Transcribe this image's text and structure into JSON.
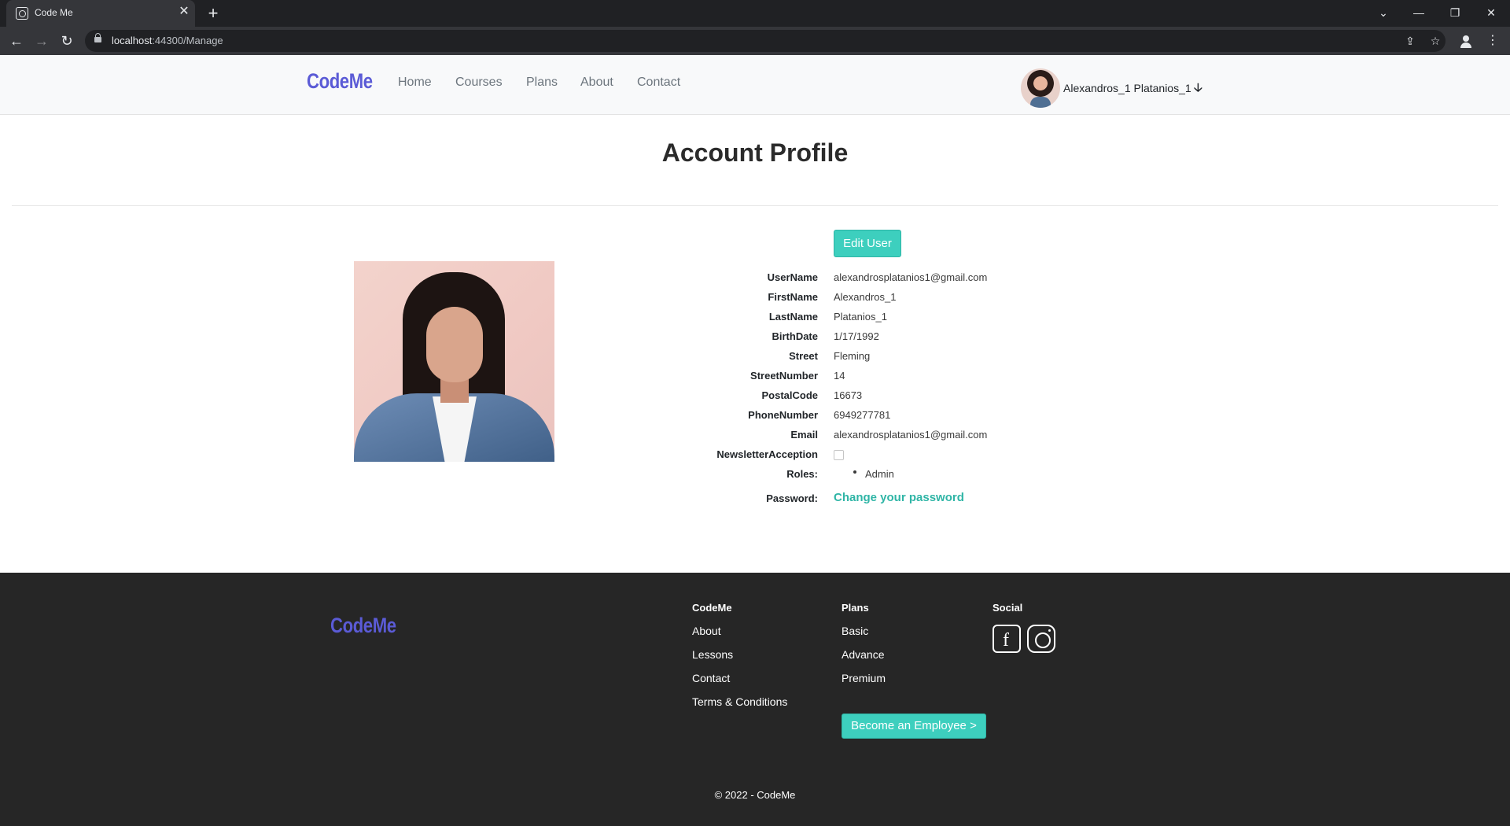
{
  "browser": {
    "tab_title": "Code Me",
    "url_host": "localhost",
    "url_rest": ":44300/Manage"
  },
  "navbar": {
    "brand": "CodeMe",
    "links": [
      "Home",
      "Courses",
      "Plans",
      "About",
      "Contact"
    ],
    "user_name": "Alexandros_1 Platanios_1",
    "user_arrow": "🡣"
  },
  "page": {
    "title": "Account Profile",
    "edit_button": "Edit User",
    "details": [
      {
        "label": "UserName",
        "value": "alexandrosplatanios1@gmail.com"
      },
      {
        "label": "FirstName",
        "value": "Alexandros_1"
      },
      {
        "label": "LastName",
        "value": "Platanios_1"
      },
      {
        "label": "BirthDate",
        "value": "1/17/1992"
      },
      {
        "label": "Street",
        "value": "Fleming"
      },
      {
        "label": "StreetNumber",
        "value": "14"
      },
      {
        "label": "PostalCode",
        "value": "16673"
      },
      {
        "label": "PhoneNumber",
        "value": "6949277781"
      },
      {
        "label": "Email",
        "value": "alexandrosplatanios1@gmail.com"
      }
    ],
    "newsletter_label": "NewsletterAcception",
    "newsletter_checked": false,
    "roles_label": "Roles:",
    "roles": [
      "Admin"
    ],
    "password_label": "Password:",
    "password_link": "Change your password"
  },
  "footer": {
    "brand": "CodeMe",
    "col1_heading": "CodeMe",
    "col1_links": [
      "About",
      "Lessons",
      "Contact",
      "Terms & Conditions"
    ],
    "col2_heading": "Plans",
    "col2_links": [
      "Basic",
      "Advance",
      "Premium"
    ],
    "col3_heading": "Social",
    "employee_button": "Become an Employee >",
    "copyright": "© 2022 - CodeMe"
  },
  "colors": {
    "brand": "#5b5bd6",
    "accent": "#3dcfbe",
    "footer_bg": "#262626"
  }
}
